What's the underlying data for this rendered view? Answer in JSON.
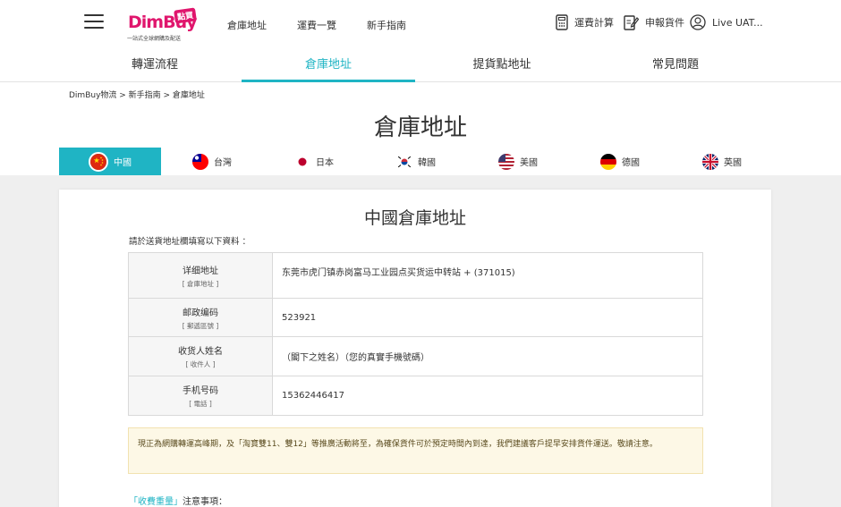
{
  "header": {
    "logo_text": "DimBuy",
    "logo_badge": "點買",
    "logo_tagline": "一站式全球網購及配送",
    "nav": [
      "倉庫地址",
      "運費一覽",
      "新手指南"
    ],
    "shipping_calc": "運費計算",
    "declare_goods": "申報貨件",
    "user": "Live UAT..."
  },
  "subnav": {
    "tabs": [
      "轉運流程",
      "倉庫地址",
      "提貨點地址",
      "常見問題"
    ],
    "active": "倉庫地址"
  },
  "breadcrumb": "DimBuy物流 > 新手指南 > 倉庫地址",
  "page_title": "倉庫地址",
  "countries": [
    {
      "name": "中國",
      "active": true
    },
    {
      "name": "台灣",
      "active": false
    },
    {
      "name": "日本",
      "active": false
    },
    {
      "name": "韓國",
      "active": false
    },
    {
      "name": "美國",
      "active": false
    },
    {
      "name": "德國",
      "active": false
    },
    {
      "name": "英國",
      "active": false
    }
  ],
  "card": {
    "title": "中國倉庫地址",
    "intro": "請於送貨地址欄填寫以下資料 ：",
    "rows": [
      {
        "label": "详细地址",
        "sub": "[ 倉庫地址 ]",
        "value": "东莞市虎门镇赤岗富马工业园点买货运中转站 + (371015)"
      },
      {
        "label": "邮政编码",
        "sub": "[ 郵遞區號 ]",
        "value": "523921"
      },
      {
        "label": "收货人姓名",
        "sub": "[ 收件人 ]",
        "value": "（閣下之姓名）（您的真實手機號碼）"
      },
      {
        "label": "手机号码",
        "sub": "[ 電話 ]",
        "value": "15362446417"
      }
    ],
    "notice": "現正為網購轉運高峰期，及「淘寶雙11、雙12」等推廣活動將至，為確保貨件可於預定時間內到達，我們建議客戶提早安排貨件運送。敬請注意。",
    "fee_heading_highlight": "「收費重量」",
    "fee_heading_rest": "注意事項："
  },
  "colors": {
    "accent": "#1fb4c4",
    "brand": "#e0166d",
    "notice_bg": "#fdf8e6"
  }
}
